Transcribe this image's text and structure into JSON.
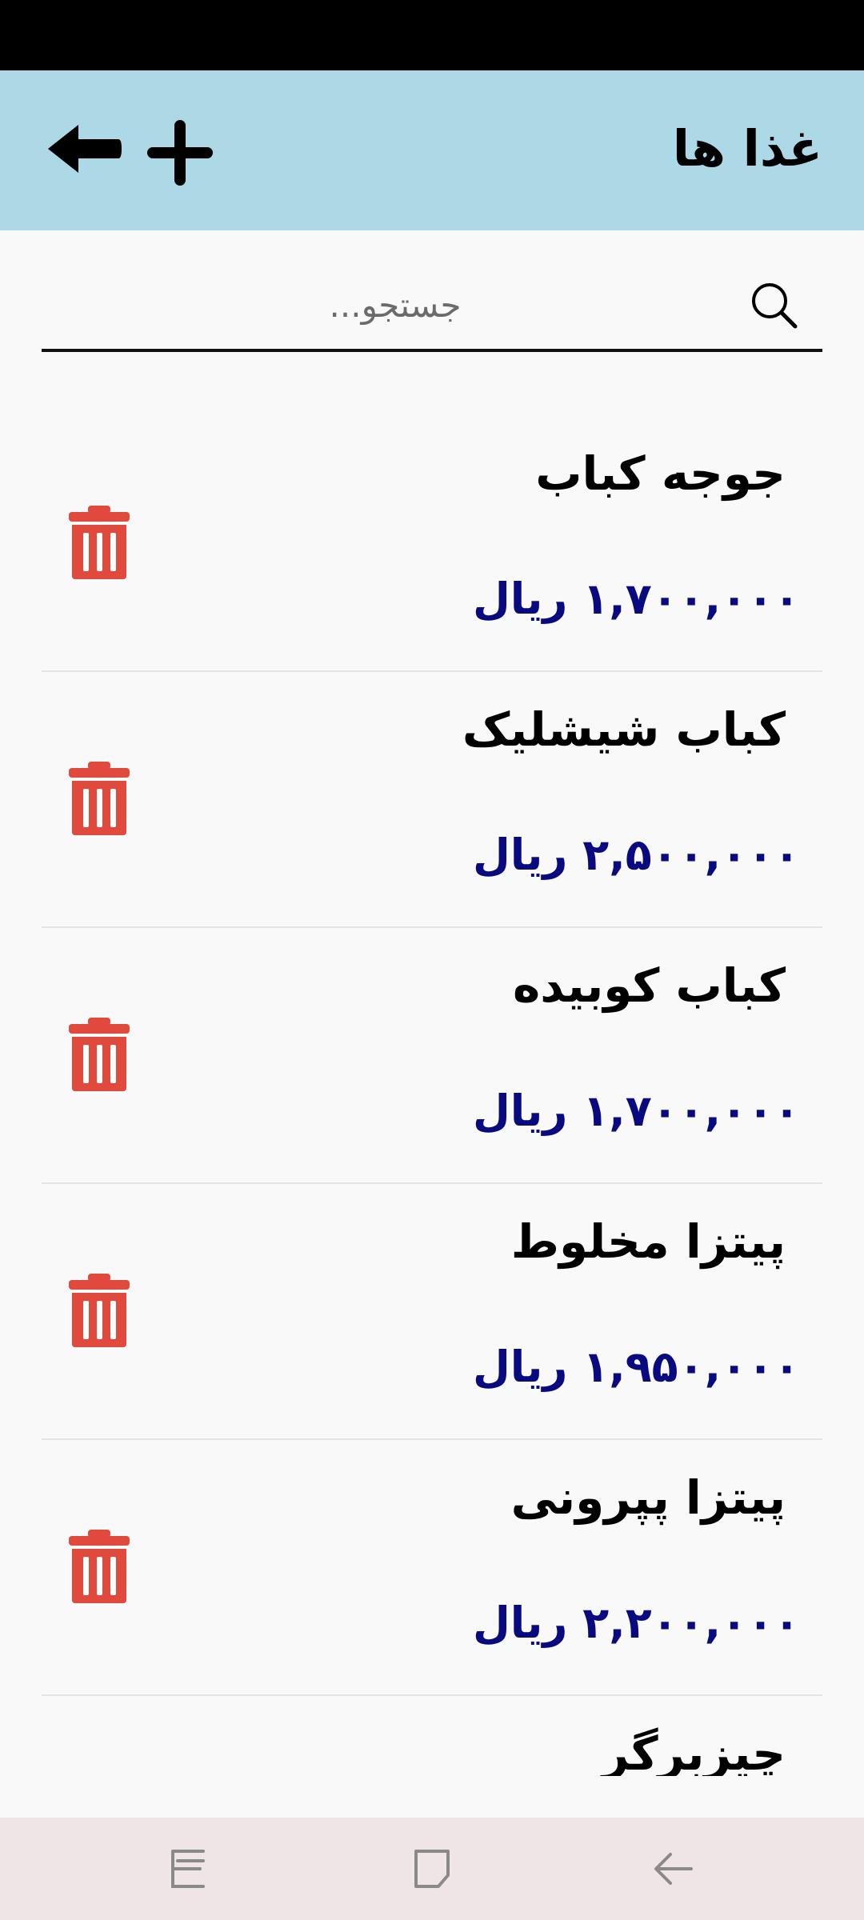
{
  "header": {
    "title": "غذا ها",
    "background": "#add8e6"
  },
  "search": {
    "placeholder": "جستجو...",
    "value": ""
  },
  "foods": [
    {
      "name": "جوجه کباب",
      "price": "۱,۷۰۰,۰۰۰ ریال"
    },
    {
      "name": "کباب شیشلیک",
      "price": "۲,۵۰۰,۰۰۰ ریال"
    },
    {
      "name": "کباب کوبیده",
      "price": "۱,۷۰۰,۰۰۰ ریال"
    },
    {
      "name": "پیتزا مخلوط",
      "price": "۱,۹۵۰,۰۰۰ ریال"
    },
    {
      "name": "پیتزا پپرونی",
      "price": "۲,۲۰۰,۰۰۰ ریال"
    },
    {
      "name": "چیزبرگر",
      "price": ""
    }
  ],
  "icons": {
    "back": "arrow-left-icon",
    "add": "plus-icon",
    "search": "search-icon",
    "delete": "trash-icon"
  },
  "colors": {
    "price": "#0a0a80",
    "delete": "#e04a3c",
    "nav_bar": "#f0e5e6"
  }
}
